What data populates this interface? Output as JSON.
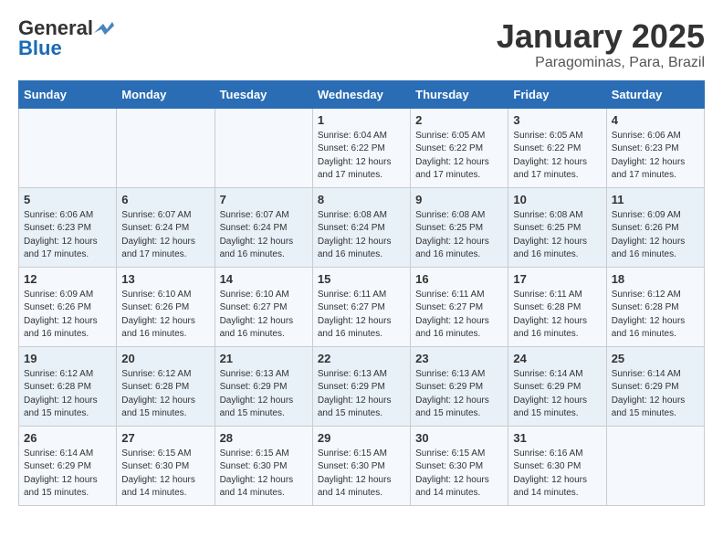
{
  "header": {
    "logo_general": "General",
    "logo_blue": "Blue",
    "month": "January 2025",
    "location": "Paragominas, Para, Brazil"
  },
  "calendar": {
    "days_of_week": [
      "Sunday",
      "Monday",
      "Tuesday",
      "Wednesday",
      "Thursday",
      "Friday",
      "Saturday"
    ],
    "weeks": [
      [
        {
          "day": "",
          "info": ""
        },
        {
          "day": "",
          "info": ""
        },
        {
          "day": "",
          "info": ""
        },
        {
          "day": "1",
          "info": "Sunrise: 6:04 AM\nSunset: 6:22 PM\nDaylight: 12 hours\nand 17 minutes."
        },
        {
          "day": "2",
          "info": "Sunrise: 6:05 AM\nSunset: 6:22 PM\nDaylight: 12 hours\nand 17 minutes."
        },
        {
          "day": "3",
          "info": "Sunrise: 6:05 AM\nSunset: 6:22 PM\nDaylight: 12 hours\nand 17 minutes."
        },
        {
          "day": "4",
          "info": "Sunrise: 6:06 AM\nSunset: 6:23 PM\nDaylight: 12 hours\nand 17 minutes."
        }
      ],
      [
        {
          "day": "5",
          "info": "Sunrise: 6:06 AM\nSunset: 6:23 PM\nDaylight: 12 hours\nand 17 minutes."
        },
        {
          "day": "6",
          "info": "Sunrise: 6:07 AM\nSunset: 6:24 PM\nDaylight: 12 hours\nand 17 minutes."
        },
        {
          "day": "7",
          "info": "Sunrise: 6:07 AM\nSunset: 6:24 PM\nDaylight: 12 hours\nand 16 minutes."
        },
        {
          "day": "8",
          "info": "Sunrise: 6:08 AM\nSunset: 6:24 PM\nDaylight: 12 hours\nand 16 minutes."
        },
        {
          "day": "9",
          "info": "Sunrise: 6:08 AM\nSunset: 6:25 PM\nDaylight: 12 hours\nand 16 minutes."
        },
        {
          "day": "10",
          "info": "Sunrise: 6:08 AM\nSunset: 6:25 PM\nDaylight: 12 hours\nand 16 minutes."
        },
        {
          "day": "11",
          "info": "Sunrise: 6:09 AM\nSunset: 6:26 PM\nDaylight: 12 hours\nand 16 minutes."
        }
      ],
      [
        {
          "day": "12",
          "info": "Sunrise: 6:09 AM\nSunset: 6:26 PM\nDaylight: 12 hours\nand 16 minutes."
        },
        {
          "day": "13",
          "info": "Sunrise: 6:10 AM\nSunset: 6:26 PM\nDaylight: 12 hours\nand 16 minutes."
        },
        {
          "day": "14",
          "info": "Sunrise: 6:10 AM\nSunset: 6:27 PM\nDaylight: 12 hours\nand 16 minutes."
        },
        {
          "day": "15",
          "info": "Sunrise: 6:11 AM\nSunset: 6:27 PM\nDaylight: 12 hours\nand 16 minutes."
        },
        {
          "day": "16",
          "info": "Sunrise: 6:11 AM\nSunset: 6:27 PM\nDaylight: 12 hours\nand 16 minutes."
        },
        {
          "day": "17",
          "info": "Sunrise: 6:11 AM\nSunset: 6:28 PM\nDaylight: 12 hours\nand 16 minutes."
        },
        {
          "day": "18",
          "info": "Sunrise: 6:12 AM\nSunset: 6:28 PM\nDaylight: 12 hours\nand 16 minutes."
        }
      ],
      [
        {
          "day": "19",
          "info": "Sunrise: 6:12 AM\nSunset: 6:28 PM\nDaylight: 12 hours\nand 15 minutes."
        },
        {
          "day": "20",
          "info": "Sunrise: 6:12 AM\nSunset: 6:28 PM\nDaylight: 12 hours\nand 15 minutes."
        },
        {
          "day": "21",
          "info": "Sunrise: 6:13 AM\nSunset: 6:29 PM\nDaylight: 12 hours\nand 15 minutes."
        },
        {
          "day": "22",
          "info": "Sunrise: 6:13 AM\nSunset: 6:29 PM\nDaylight: 12 hours\nand 15 minutes."
        },
        {
          "day": "23",
          "info": "Sunrise: 6:13 AM\nSunset: 6:29 PM\nDaylight: 12 hours\nand 15 minutes."
        },
        {
          "day": "24",
          "info": "Sunrise: 6:14 AM\nSunset: 6:29 PM\nDaylight: 12 hours\nand 15 minutes."
        },
        {
          "day": "25",
          "info": "Sunrise: 6:14 AM\nSunset: 6:29 PM\nDaylight: 12 hours\nand 15 minutes."
        }
      ],
      [
        {
          "day": "26",
          "info": "Sunrise: 6:14 AM\nSunset: 6:29 PM\nDaylight: 12 hours\nand 15 minutes."
        },
        {
          "day": "27",
          "info": "Sunrise: 6:15 AM\nSunset: 6:30 PM\nDaylight: 12 hours\nand 14 minutes."
        },
        {
          "day": "28",
          "info": "Sunrise: 6:15 AM\nSunset: 6:30 PM\nDaylight: 12 hours\nand 14 minutes."
        },
        {
          "day": "29",
          "info": "Sunrise: 6:15 AM\nSunset: 6:30 PM\nDaylight: 12 hours\nand 14 minutes."
        },
        {
          "day": "30",
          "info": "Sunrise: 6:15 AM\nSunset: 6:30 PM\nDaylight: 12 hours\nand 14 minutes."
        },
        {
          "day": "31",
          "info": "Sunrise: 6:16 AM\nSunset: 6:30 PM\nDaylight: 12 hours\nand 14 minutes."
        },
        {
          "day": "",
          "info": ""
        }
      ]
    ]
  }
}
